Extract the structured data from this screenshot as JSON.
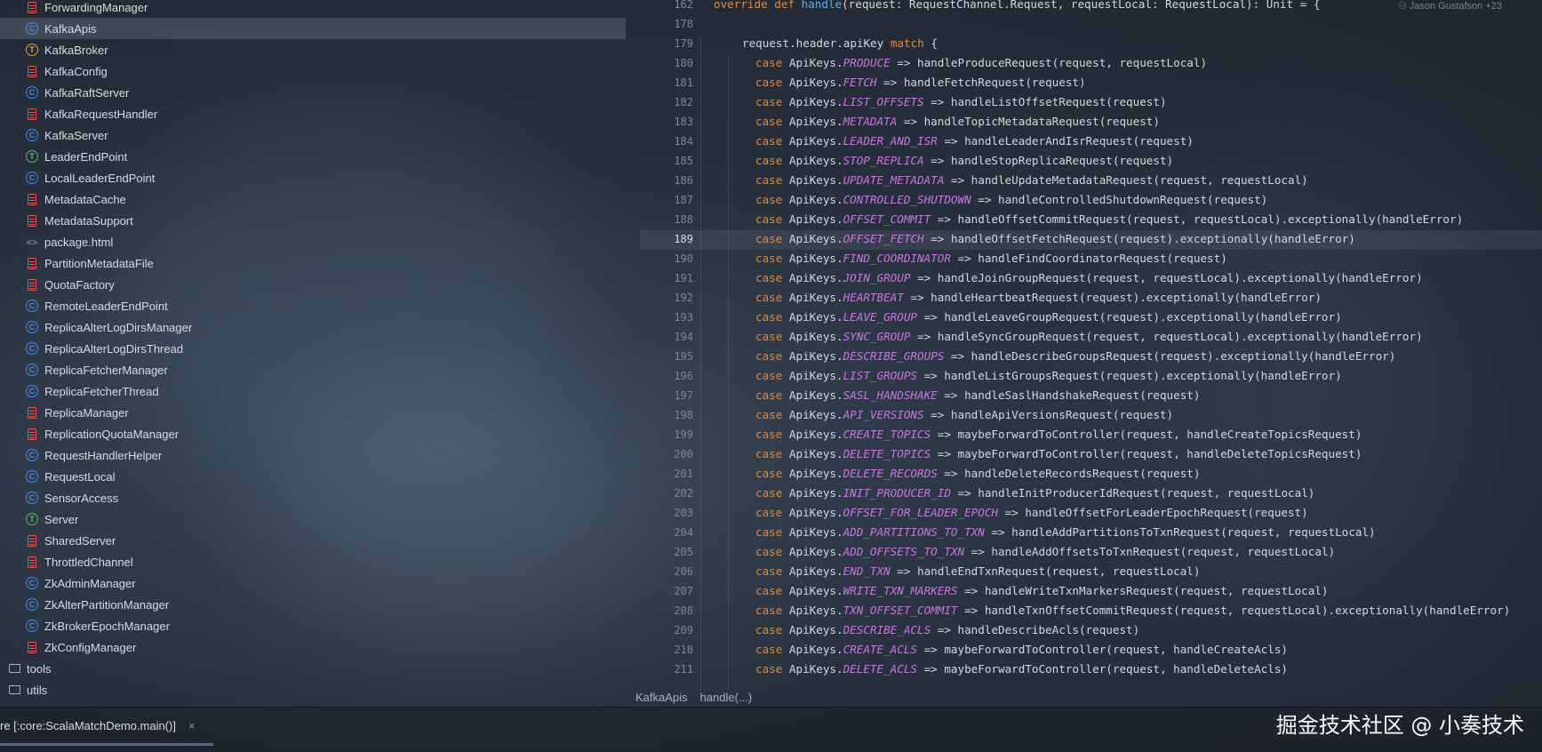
{
  "tree": {
    "items": [
      {
        "label": "ForwardingManager",
        "icon": "file-red"
      },
      {
        "label": "KafkaApis",
        "icon": "class-blue",
        "selected": true
      },
      {
        "label": "KafkaBroker",
        "icon": "trait-orange"
      },
      {
        "label": "KafkaConfig",
        "icon": "file-red"
      },
      {
        "label": "KafkaRaftServer",
        "icon": "class-blue"
      },
      {
        "label": "KafkaRequestHandler",
        "icon": "file-red"
      },
      {
        "label": "KafkaServer",
        "icon": "class-blue"
      },
      {
        "label": "LeaderEndPoint",
        "icon": "trait-green"
      },
      {
        "label": "LocalLeaderEndPoint",
        "icon": "class-blue"
      },
      {
        "label": "MetadataCache",
        "icon": "file-red"
      },
      {
        "label": "MetadataSupport",
        "icon": "file-red"
      },
      {
        "label": "package.html",
        "icon": "html-file"
      },
      {
        "label": "PartitionMetadataFile",
        "icon": "file-red"
      },
      {
        "label": "QuotaFactory",
        "icon": "file-red"
      },
      {
        "label": "RemoteLeaderEndPoint",
        "icon": "class-blue"
      },
      {
        "label": "ReplicaAlterLogDirsManager",
        "icon": "class-blue"
      },
      {
        "label": "ReplicaAlterLogDirsThread",
        "icon": "class-blue"
      },
      {
        "label": "ReplicaFetcherManager",
        "icon": "class-blue"
      },
      {
        "label": "ReplicaFetcherThread",
        "icon": "class-blue"
      },
      {
        "label": "ReplicaManager",
        "icon": "file-red"
      },
      {
        "label": "ReplicationQuotaManager",
        "icon": "file-red"
      },
      {
        "label": "RequestHandlerHelper",
        "icon": "class-blue"
      },
      {
        "label": "RequestLocal",
        "icon": "class-blue"
      },
      {
        "label": "SensorAccess",
        "icon": "class-blue"
      },
      {
        "label": "Server",
        "icon": "trait-green"
      },
      {
        "label": "SharedServer",
        "icon": "file-red"
      },
      {
        "label": "ThrottledChannel",
        "icon": "file-red"
      },
      {
        "label": "ZkAdminManager",
        "icon": "class-blue"
      },
      {
        "label": "ZkAlterPartitionManager",
        "icon": "class-blue"
      },
      {
        "label": "ZkBrokerEpochManager",
        "icon": "class-blue"
      },
      {
        "label": "ZkConfigManager",
        "icon": "file-red"
      },
      {
        "label": "tools",
        "icon": "folder"
      },
      {
        "label": "utils",
        "icon": "folder"
      }
    ]
  },
  "editor": {
    "blame": "Jason Gustafson +23",
    "header_line": {
      "number": "162",
      "text": "override def handle(request: RequestChannel.Request, requestLocal: RequestLocal): Unit = {"
    },
    "active_line": "189",
    "lines": [
      {
        "n": "178",
        "indent": 0,
        "text": ""
      },
      {
        "n": "179",
        "indent": 1,
        "text": "request.header.apiKey match {"
      },
      {
        "n": "180",
        "case": "PRODUCE",
        "rest": " => handleProduceRequest(request, requestLocal)"
      },
      {
        "n": "181",
        "case": "FETCH",
        "rest": " => handleFetchRequest(request)"
      },
      {
        "n": "182",
        "case": "LIST_OFFSETS",
        "rest": " => handleListOffsetRequest(request)"
      },
      {
        "n": "183",
        "case": "METADATA",
        "rest": " => handleTopicMetadataRequest(request)"
      },
      {
        "n": "184",
        "case": "LEADER_AND_ISR",
        "rest": " => handleLeaderAndIsrRequest(request)"
      },
      {
        "n": "185",
        "case": "STOP_REPLICA",
        "rest": " => handleStopReplicaRequest(request)"
      },
      {
        "n": "186",
        "case": "UPDATE_METADATA",
        "rest": " => handleUpdateMetadataRequest(request, requestLocal)"
      },
      {
        "n": "187",
        "case": "CONTROLLED_SHUTDOWN",
        "rest": " => handleControlledShutdownRequest(request)"
      },
      {
        "n": "188",
        "case": "OFFSET_COMMIT",
        "rest": " => handleOffsetCommitRequest(request, requestLocal).exceptionally(handleError)"
      },
      {
        "n": "189",
        "case": "OFFSET_FETCH",
        "rest": " => handleOffsetFetchRequest(request).exceptionally(handleError)"
      },
      {
        "n": "190",
        "case": "FIND_COORDINATOR",
        "rest": " => handleFindCoordinatorRequest(request)"
      },
      {
        "n": "191",
        "case": "JOIN_GROUP",
        "rest": " => handleJoinGroupRequest(request, requestLocal).exceptionally(handleError)"
      },
      {
        "n": "192",
        "case": "HEARTBEAT",
        "rest": " => handleHeartbeatRequest(request).exceptionally(handleError)"
      },
      {
        "n": "193",
        "case": "LEAVE_GROUP",
        "rest": " => handleLeaveGroupRequest(request).exceptionally(handleError)"
      },
      {
        "n": "194",
        "case": "SYNC_GROUP",
        "rest": " => handleSyncGroupRequest(request, requestLocal).exceptionally(handleError)"
      },
      {
        "n": "195",
        "case": "DESCRIBE_GROUPS",
        "rest": " => handleDescribeGroupsRequest(request).exceptionally(handleError)"
      },
      {
        "n": "196",
        "case": "LIST_GROUPS",
        "rest": " => handleListGroupsRequest(request).exceptionally(handleError)"
      },
      {
        "n": "197",
        "case": "SASL_HANDSHAKE",
        "rest": " => handleSaslHandshakeRequest(request)"
      },
      {
        "n": "198",
        "case": "API_VERSIONS",
        "rest": " => handleApiVersionsRequest(request)"
      },
      {
        "n": "199",
        "case": "CREATE_TOPICS",
        "rest": " => maybeForwardToController(request, handleCreateTopicsRequest)"
      },
      {
        "n": "200",
        "case": "DELETE_TOPICS",
        "rest": " => maybeForwardToController(request, handleDeleteTopicsRequest)"
      },
      {
        "n": "201",
        "case": "DELETE_RECORDS",
        "rest": " => handleDeleteRecordsRequest(request)"
      },
      {
        "n": "202",
        "case": "INIT_PRODUCER_ID",
        "rest": " => handleInitProducerIdRequest(request, requestLocal)"
      },
      {
        "n": "203",
        "case": "OFFSET_FOR_LEADER_EPOCH",
        "rest": " => handleOffsetForLeaderEpochRequest(request)"
      },
      {
        "n": "204",
        "case": "ADD_PARTITIONS_TO_TXN",
        "rest": " => handleAddPartitionsToTxnRequest(request, requestLocal)"
      },
      {
        "n": "205",
        "case": "ADD_OFFSETS_TO_TXN",
        "rest": " => handleAddOffsetsToTxnRequest(request, requestLocal)"
      },
      {
        "n": "206",
        "case": "END_TXN",
        "rest": " => handleEndTxnRequest(request, requestLocal)"
      },
      {
        "n": "207",
        "case": "WRITE_TXN_MARKERS",
        "rest": " => handleWriteTxnMarkersRequest(request, requestLocal)"
      },
      {
        "n": "208",
        "case": "TXN_OFFSET_COMMIT",
        "rest": " => handleTxnOffsetCommitRequest(request, requestLocal).exceptionally(handleError)"
      },
      {
        "n": "209",
        "case": "DESCRIBE_ACLS",
        "rest": " => handleDescribeAcls(request)"
      },
      {
        "n": "210",
        "case": "CREATE_ACLS",
        "rest": " => maybeForwardToController(request, handleCreateAcls)"
      },
      {
        "n": "211",
        "case": "DELETE_ACLS",
        "rest": " => maybeForwardToController(request, handleDeleteAcls)"
      }
    ],
    "keyword_case": "case",
    "api_prefix": "ApiKeys."
  },
  "breadcrumb": {
    "items": [
      "KafkaApis",
      "handle(...)"
    ]
  },
  "bottom": {
    "run_tab_label": "re [:core:ScalaMatchDemo.main()]",
    "close_glyph": "×",
    "watermark": "掘金技术社区 @ 小奏技术"
  }
}
